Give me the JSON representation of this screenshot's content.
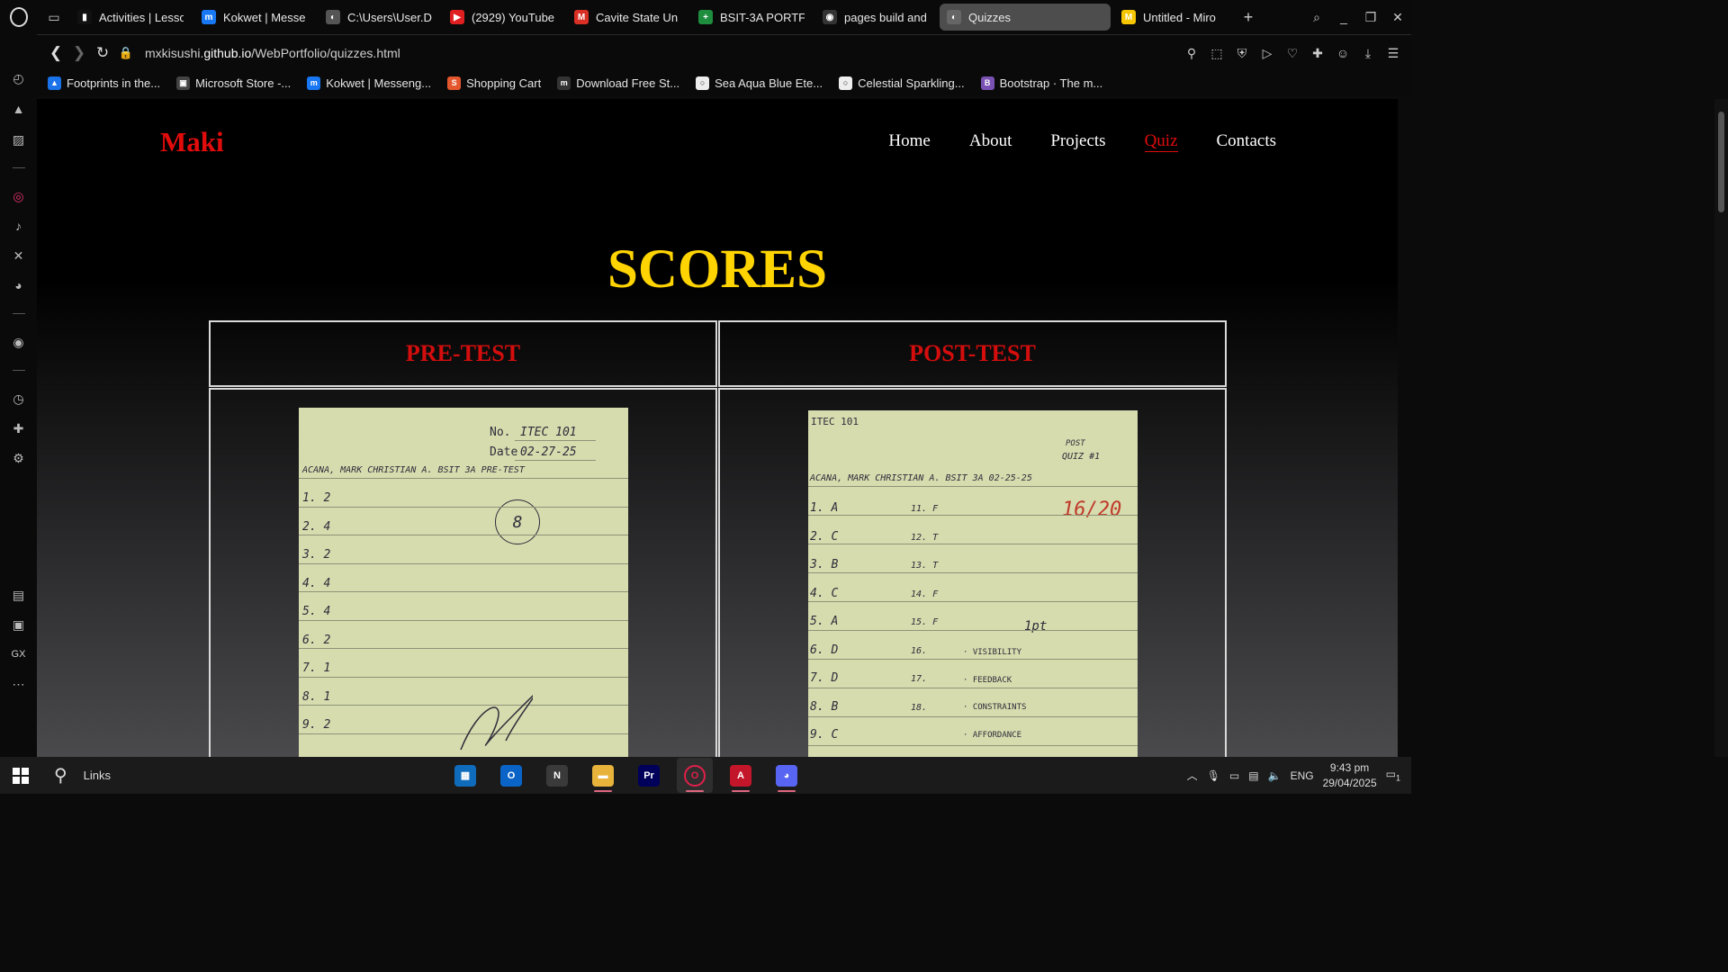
{
  "browser": {
    "tabs": [
      {
        "label": "Activities | Lesso",
        "icon": "bookmark-icon",
        "color": "#111111",
        "glyph": "▮"
      },
      {
        "label": "Kokwet | Messe",
        "icon": "messenger-icon",
        "color": "#1877f2",
        "glyph": "m"
      },
      {
        "label": "C:\\Users\\User.D",
        "icon": "globe-icon",
        "color": "#555555",
        "glyph": "◐"
      },
      {
        "label": "(2929) YouTube",
        "icon": "youtube-icon",
        "color": "#e02020",
        "glyph": "▶"
      },
      {
        "label": "Cavite State Un",
        "icon": "gmail-icon",
        "color": "#d93025",
        "glyph": "M"
      },
      {
        "label": "BSIT-3A PORTF",
        "icon": "sheets-icon",
        "color": "#1e8e3e",
        "glyph": "+"
      },
      {
        "label": "pages build and",
        "icon": "github-icon",
        "color": "#333333",
        "glyph": "◉"
      },
      {
        "label": "Quizzes",
        "icon": "globe-icon",
        "color": "#666666",
        "glyph": "◐",
        "active": true
      },
      {
        "label": "Untitled - Miro",
        "icon": "miro-icon",
        "color": "#f7c600",
        "glyph": "M"
      }
    ],
    "new_tab": "+",
    "window_controls": {
      "search": "⌕",
      "minimize": "_",
      "restore": "❐",
      "close": "✕"
    },
    "url_prefix": "mxkisushi.",
    "url_domain": "github.io",
    "url_path": "/WebPortfolio/quizzes.html",
    "bookmarks": [
      {
        "label": "Footprints in the...",
        "icon": "drive-icon",
        "color": "#1a73e8",
        "glyph": "▲"
      },
      {
        "label": "Microsoft Store -...",
        "icon": "store-icon",
        "color": "#444444",
        "glyph": "▣"
      },
      {
        "label": "Kokwet | Messeng...",
        "icon": "messenger-icon",
        "color": "#1877f2",
        "glyph": "m"
      },
      {
        "label": "Shopping Cart",
        "icon": "cart-icon",
        "color": "#e4572e",
        "glyph": "S"
      },
      {
        "label": "Download Free St...",
        "icon": "download-site-icon",
        "color": "#333333",
        "glyph": "m"
      },
      {
        "label": "Sea Aqua Blue Ete...",
        "icon": "ring-icon",
        "color": "#eeeeee",
        "glyph": "○"
      },
      {
        "label": "Celestial Sparkling...",
        "icon": "ring-icon",
        "color": "#eeeeee",
        "glyph": "○"
      },
      {
        "label": "Bootstrap · The m...",
        "icon": "bootstrap-icon",
        "color": "#7952b3",
        "glyph": "B"
      }
    ]
  },
  "site": {
    "logo": "Maki",
    "nav": [
      {
        "label": "Home",
        "active": false
      },
      {
        "label": "About",
        "active": false
      },
      {
        "label": "Projects",
        "active": false
      },
      {
        "label": "Quiz",
        "active": true
      },
      {
        "label": "Contacts",
        "active": false
      }
    ],
    "title": "SCORES",
    "pre_test_header": "PRE-TEST",
    "post_test_header": "POST-TEST"
  },
  "pre_paper": {
    "no_label": "No.",
    "no_value": "ITEC 101",
    "date_label": "Date",
    "date_value": "02-27-25",
    "name_line": "ACANA, MARK CHRISTIAN A.   BSIT 3A    PRE-TEST",
    "score": "8",
    "answers": [
      "1. 2",
      "2. 4",
      "3. 2",
      "4. 4",
      "5. 4",
      "6. 2",
      "7. 1",
      "8. 1",
      "9. 2"
    ]
  },
  "post_paper": {
    "course": "ITEC 101",
    "note_top": "POST",
    "quiz_label": "QUIZ #1",
    "name_line": "ACANA, MARK CHRISTIAN A.    BSIT 3A     02-25-25",
    "score": "16/20",
    "points_note": "1pt",
    "answers_left": [
      "1. A",
      "2. C",
      "3. B",
      "4. C",
      "5. A",
      "6. D",
      "7. D",
      "8. B",
      "9. C"
    ],
    "answers_right": [
      "11. F",
      "12. T",
      "13. T",
      "14. F",
      "15. F",
      "16.",
      "17.",
      "18."
    ],
    "terms": [
      "· VISIBILITY",
      "· FEEDBACK",
      "· CONSTRAINTS",
      "· AFFORDANCE"
    ]
  },
  "taskbar": {
    "search_label": "Links",
    "apps": [
      {
        "name": "ms-store-icon",
        "color": "#0f6cbd",
        "glyph": "▦",
        "running": false
      },
      {
        "name": "outlook-icon",
        "color": "#0a64c8",
        "glyph": "O",
        "running": false
      },
      {
        "name": "notion-icon",
        "color": "#3a3a3a",
        "glyph": "N",
        "running": false
      },
      {
        "name": "file-explorer-icon",
        "color": "#e8b33b",
        "glyph": "▬",
        "running": true
      },
      {
        "name": "premiere-pro-icon",
        "color": "#00005b",
        "glyph": "Pr",
        "running": false
      },
      {
        "name": "opera-gx-icon",
        "color": "#1b1b1b",
        "glyph": "O",
        "running": true,
        "active": true
      },
      {
        "name": "autocad-icon",
        "color": "#c4162a",
        "glyph": "A",
        "running": true
      },
      {
        "name": "discord-icon",
        "color": "#5865f2",
        "glyph": "◕",
        "running": true
      }
    ],
    "language": "ENG",
    "time": "9:43 pm",
    "date": "29/04/2025",
    "notification_count": "1"
  }
}
